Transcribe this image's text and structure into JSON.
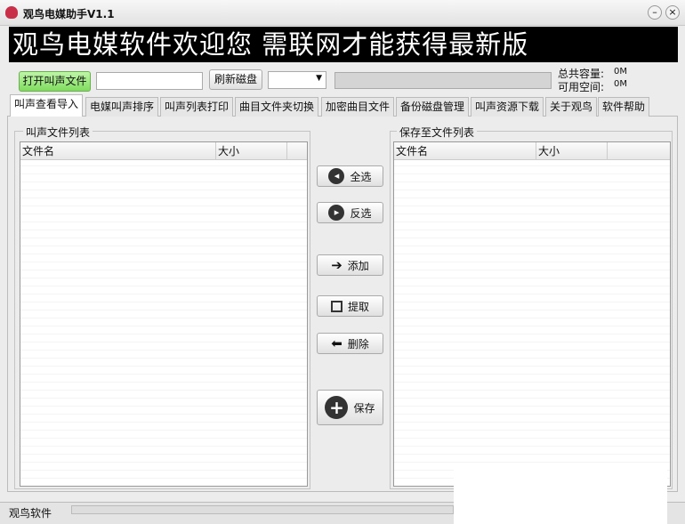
{
  "window": {
    "title": "观鸟电媒助手V1.1",
    "minimize": "–",
    "close": "×"
  },
  "banner": "观鸟电媒软件欢迎您  需联网才能获得最新版",
  "toolbar": {
    "open_label": "打开叫声文件",
    "path_value": "",
    "refresh_label": "刷新磁盘",
    "drive_value": "",
    "total_label": "总共容量:",
    "total_value": "0M",
    "free_label": "可用空间:",
    "free_value": "0M",
    "progress": 0
  },
  "tabs": [
    "叫声查看导入",
    "电媒叫声排序",
    "叫声列表打印",
    "曲目文件夹切换",
    "加密曲目文件",
    "备份磁盘管理",
    "叫声资源下载",
    "关于观鸟",
    "软件帮助"
  ],
  "left_list": {
    "title": "叫声文件列表",
    "columns": [
      "文件名",
      "大小"
    ]
  },
  "right_list": {
    "title": "保存至文件列表",
    "columns": [
      "文件名",
      "大小"
    ]
  },
  "actions": {
    "select_all": "全选",
    "invert": "反选",
    "add": "添加",
    "extract": "提取",
    "delete": "删除",
    "save": "保存"
  },
  "status": "观鸟软件"
}
